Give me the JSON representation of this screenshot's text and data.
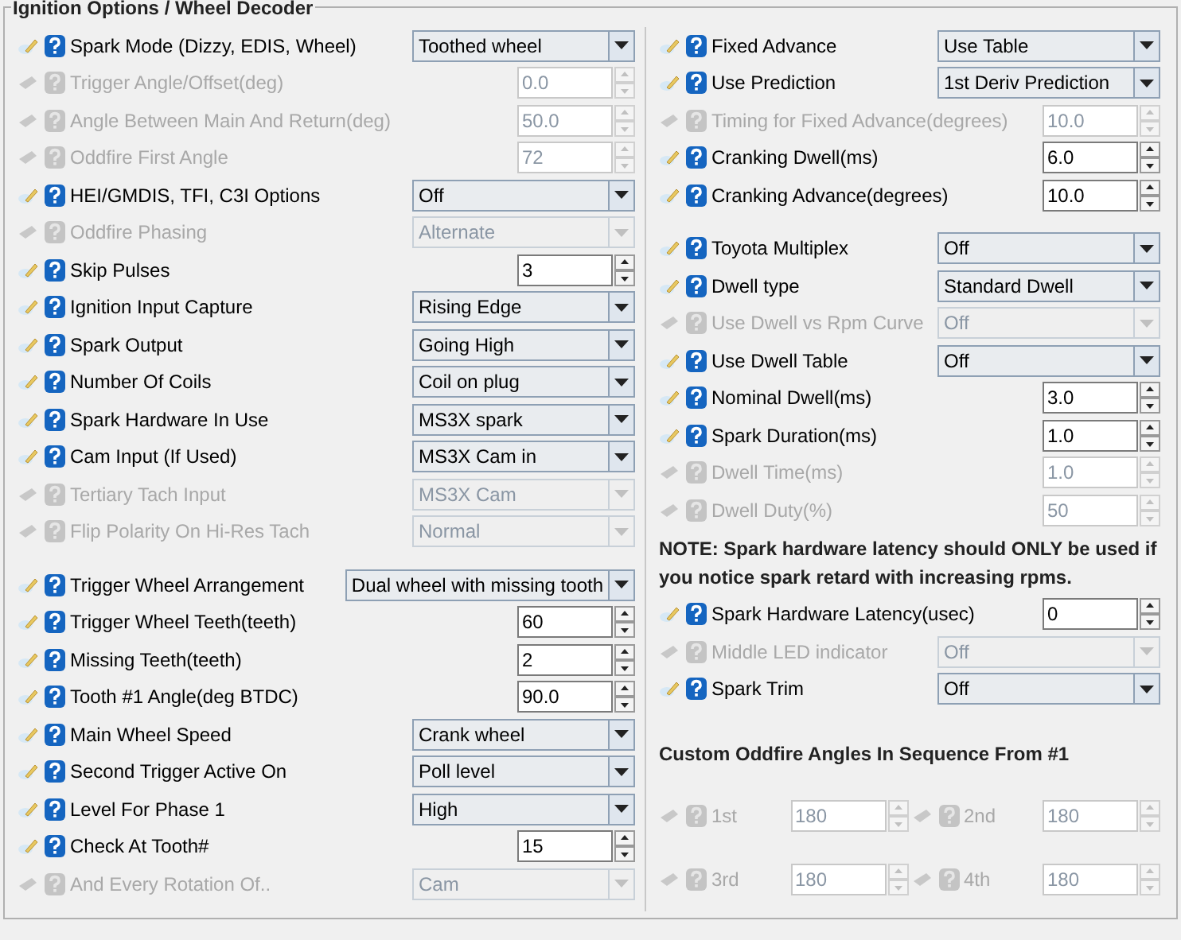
{
  "panel": {
    "title": "Ignition Options / Wheel Decoder",
    "left_rows": [
      {
        "kind": "select",
        "label": "Spark Mode (Dizzy, EDIS, Wheel)",
        "value": "Toothed wheel",
        "disabled": false
      },
      {
        "kind": "spinner",
        "label": "Trigger Angle/Offset(deg)",
        "value": "0.0",
        "disabled": true
      },
      {
        "kind": "spinner",
        "label": "Angle Between Main And Return(deg)",
        "value": "50.0",
        "disabled": true
      },
      {
        "kind": "spinner",
        "label": "Oddfire First Angle",
        "value": "72",
        "disabled": true
      },
      {
        "kind": "select",
        "label": "HEI/GMDIS, TFI, C3I Options",
        "value": "Off",
        "disabled": false
      },
      {
        "kind": "select",
        "label": "Oddfire Phasing",
        "value": "Alternate",
        "disabled": true
      },
      {
        "kind": "spinner",
        "label": "Skip Pulses",
        "value": "3",
        "disabled": false
      },
      {
        "kind": "select",
        "label": "Ignition Input Capture",
        "value": "Rising Edge",
        "disabled": false
      },
      {
        "kind": "select",
        "label": "Spark Output",
        "value": "Going High",
        "disabled": false
      },
      {
        "kind": "select",
        "label": "Number Of Coils",
        "value": "Coil on plug",
        "disabled": false
      },
      {
        "kind": "select",
        "label": "Spark Hardware In Use",
        "value": "MS3X spark",
        "disabled": false
      },
      {
        "kind": "select",
        "label": "Cam Input (If Used)",
        "value": "MS3X Cam in",
        "disabled": false
      },
      {
        "kind": "select",
        "label": "Tertiary Tach Input",
        "value": "MS3X Cam",
        "disabled": true
      },
      {
        "kind": "select",
        "label": "Flip Polarity On Hi-Res Tach",
        "value": "Normal",
        "disabled": true
      },
      {
        "kind": "spacer"
      },
      {
        "kind": "select",
        "label": "Trigger Wheel Arrangement",
        "value": "Dual wheel with missing tooth",
        "disabled": false
      },
      {
        "kind": "spinner",
        "label": "Trigger Wheel Teeth(teeth)",
        "value": "60",
        "disabled": false
      },
      {
        "kind": "spinner",
        "label": "Missing Teeth(teeth)",
        "value": "2",
        "disabled": false
      },
      {
        "kind": "spinner",
        "label": "Tooth #1 Angle(deg BTDC)",
        "value": "90.0",
        "disabled": false
      },
      {
        "kind": "select",
        "label": "Main Wheel Speed",
        "value": "Crank wheel",
        "disabled": false
      },
      {
        "kind": "select",
        "label": "Second Trigger Active On",
        "value": "Poll level",
        "disabled": false
      },
      {
        "kind": "select",
        "label": "Level For Phase 1",
        "value": "High",
        "disabled": false
      },
      {
        "kind": "spinner",
        "label": "Check At Tooth#",
        "value": "15",
        "disabled": false
      },
      {
        "kind": "select",
        "label": "And Every Rotation Of..",
        "value": "Cam",
        "disabled": true
      }
    ],
    "right_rows": [
      {
        "kind": "select",
        "label": "Fixed Advance",
        "value": "Use Table",
        "disabled": false
      },
      {
        "kind": "select",
        "label": "Use Prediction",
        "value": "1st Deriv Prediction",
        "disabled": false
      },
      {
        "kind": "spinner",
        "label": "Timing for Fixed Advance(degrees)",
        "value": "10.0",
        "disabled": true
      },
      {
        "kind": "spinner",
        "label": "Cranking Dwell(ms)",
        "value": "6.0",
        "disabled": false
      },
      {
        "kind": "spinner",
        "label": "Cranking Advance(degrees)",
        "value": "10.0",
        "disabled": false
      },
      {
        "kind": "spacer"
      },
      {
        "kind": "select",
        "label": "Toyota Multiplex",
        "value": "Off",
        "disabled": false
      },
      {
        "kind": "select",
        "label": "Dwell type",
        "value": "Standard Dwell",
        "disabled": false
      },
      {
        "kind": "select",
        "label": "Use Dwell vs Rpm Curve",
        "value": "Off",
        "disabled": true
      },
      {
        "kind": "select",
        "label": "Use Dwell Table",
        "value": "Off",
        "disabled": false
      },
      {
        "kind": "spinner",
        "label": "Nominal Dwell(ms)",
        "value": "3.0",
        "disabled": false
      },
      {
        "kind": "spinner",
        "label": "Spark Duration(ms)",
        "value": "1.0",
        "disabled": false
      },
      {
        "kind": "spinner",
        "label": "Dwell Time(ms)",
        "value": "1.0",
        "disabled": true
      },
      {
        "kind": "spinner",
        "label": "Dwell Duty(%)",
        "value": "50",
        "disabled": true
      },
      {
        "kind": "note",
        "text": "NOTE: Spark hardware latency should ONLY be used if you notice spark retard with increasing rpms."
      },
      {
        "kind": "spinner",
        "label": "Spark Hardware Latency(usec)",
        "value": "0",
        "disabled": false
      },
      {
        "kind": "select",
        "label": "Middle LED indicator",
        "value": "Off",
        "disabled": true
      },
      {
        "kind": "select",
        "label": "Spark Trim",
        "value": "Off",
        "disabled": false
      },
      {
        "kind": "spacer"
      },
      {
        "kind": "heading",
        "text": "Custom Oddfire Angles In Sequence From #1"
      },
      {
        "kind": "pair",
        "items": [
          {
            "label": "1st",
            "value": "180",
            "disabled": true
          },
          {
            "label": "2nd",
            "value": "180",
            "disabled": true
          }
        ]
      },
      {
        "kind": "pair",
        "items": [
          {
            "label": "3rd",
            "value": "180",
            "disabled": true
          },
          {
            "label": "4th",
            "value": "180",
            "disabled": true
          }
        ]
      }
    ]
  }
}
